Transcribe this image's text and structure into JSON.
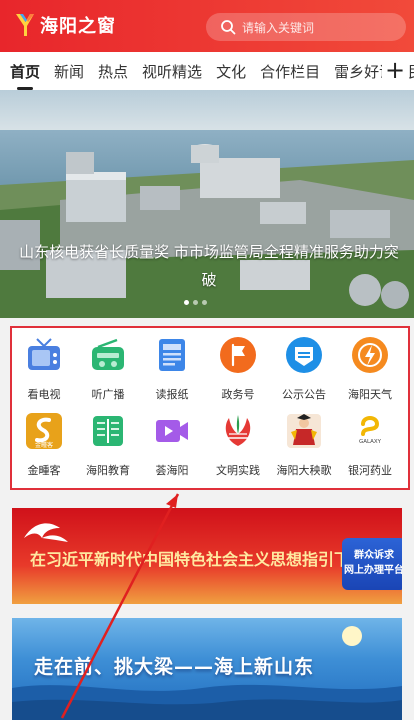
{
  "header": {
    "logo_text": "海阳之窗",
    "search_placeholder": "请输入关键词"
  },
  "tabs": [
    {
      "label": "首页",
      "active": true
    },
    {
      "label": "新闻"
    },
    {
      "label": "热点"
    },
    {
      "label": "视听精选"
    },
    {
      "label": "文化"
    },
    {
      "label": "合作栏目"
    },
    {
      "label": "雷乡好课"
    },
    {
      "label": "民"
    }
  ],
  "tabs_more": "+",
  "banner": {
    "caption": "山东核电获省长质量奖 市市场监管局全程精准服务助力突破",
    "slide_index": 1,
    "slide_count": 3
  },
  "services": [
    {
      "label": "看电视",
      "icon": "tv-icon",
      "color": "#4a7fe0"
    },
    {
      "label": "听广播",
      "icon": "radio-icon",
      "color": "#2bb673"
    },
    {
      "label": "读报纸",
      "icon": "newspaper-icon",
      "color": "#3d86e8"
    },
    {
      "label": "政务号",
      "icon": "flag-icon",
      "color": "#f26b1d"
    },
    {
      "label": "公示公告",
      "icon": "announcement-icon",
      "color": "#1e8fe6"
    },
    {
      "label": "海阳天气",
      "icon": "weather-icon",
      "color": "#f58a1f"
    },
    {
      "label": "金畽客",
      "icon": "jintuanke-icon",
      "color": "#e8a21a",
      "badge": "金畽客"
    },
    {
      "label": "海阳教育",
      "icon": "book-icon",
      "color": "#2bb673"
    },
    {
      "label": "荟海阳",
      "icon": "video-icon",
      "color": "#a45be8"
    },
    {
      "label": "文明实践",
      "icon": "civilization-icon",
      "color": "#e53935"
    },
    {
      "label": "海阳大秧歌",
      "icon": "yangge-icon",
      "color": "#c62828"
    },
    {
      "label": "银河药业",
      "icon": "galaxy-icon",
      "color": "#f2b705",
      "badge": "GALAXY"
    }
  ],
  "ads": {
    "banner1_text": "在习近平新时代中国特色社会主义思想指引下",
    "banner1_badge_line1": "群众诉求",
    "banner1_badge_line2": "网上办理平台",
    "banner2_text": "走在前、挑大梁——海上新山东"
  }
}
